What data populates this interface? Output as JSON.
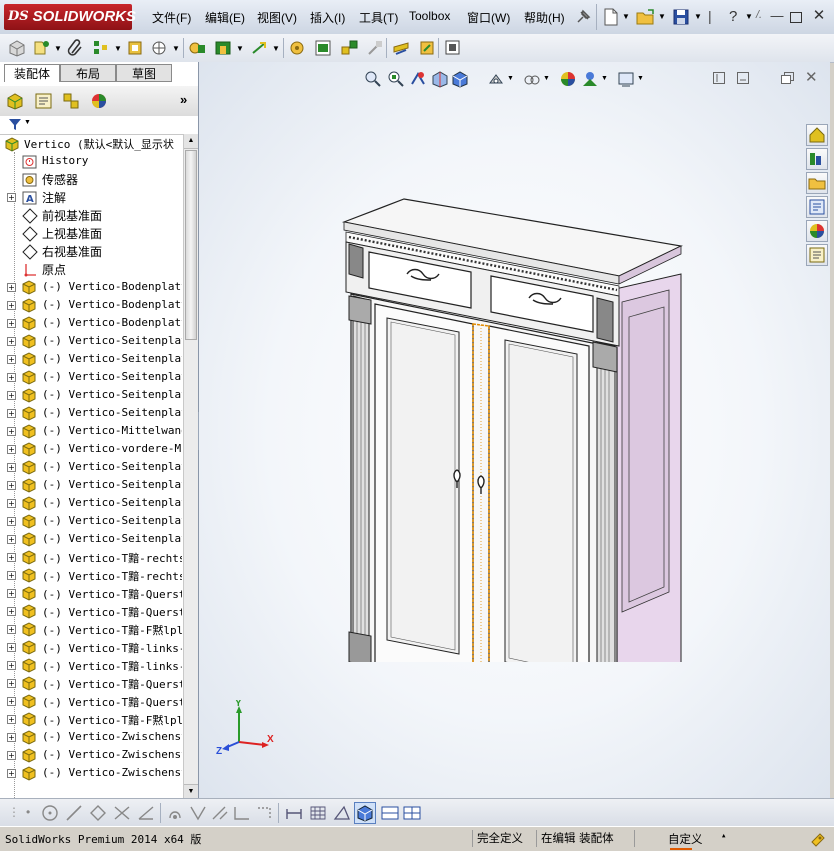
{
  "app": {
    "brand": "SOLIDWORKS",
    "brand_prefix": "DS",
    "menus": [
      {
        "label": "文件(F)"
      },
      {
        "label": "编辑(E)"
      },
      {
        "label": "视图(V)"
      },
      {
        "label": "插入(I)"
      },
      {
        "label": "工具(T)"
      },
      {
        "label": "Toolbox"
      },
      {
        "label": "窗口(W)"
      },
      {
        "label": "帮助(H)"
      }
    ]
  },
  "panel": {
    "tabs": [
      {
        "label": "装配体",
        "active": true
      },
      {
        "label": "布局",
        "active": false
      },
      {
        "label": "草图",
        "active": false
      }
    ],
    "tree": [
      {
        "label": "Vertico  (默认<默认_显示状",
        "icon": "assembly-icon",
        "expand": "",
        "cjk": false,
        "level": 0
      },
      {
        "label": "History",
        "icon": "history-icon",
        "expand": "",
        "cjk": false,
        "level": 1
      },
      {
        "label": "传感器",
        "icon": "sensor-icon",
        "expand": "",
        "cjk": true,
        "level": 1
      },
      {
        "label": "注解",
        "icon": "annotation-icon",
        "expand": "+",
        "cjk": true,
        "level": 1
      },
      {
        "label": "前视基准面",
        "icon": "plane-icon",
        "expand": "",
        "cjk": true,
        "level": 1
      },
      {
        "label": "上视基准面",
        "icon": "plane-icon",
        "expand": "",
        "cjk": true,
        "level": 1
      },
      {
        "label": "右视基准面",
        "icon": "plane-icon",
        "expand": "",
        "cjk": true,
        "level": 1
      },
      {
        "label": "原点",
        "icon": "origin-icon",
        "expand": "",
        "cjk": true,
        "level": 1
      },
      {
        "label": "(-) Vertico-Bodenplatte",
        "icon": "part-icon",
        "expand": "+",
        "cjk": false,
        "level": 1
      },
      {
        "label": "(-) Vertico-Bodenplatte",
        "icon": "part-icon",
        "expand": "+",
        "cjk": false,
        "level": 1
      },
      {
        "label": "(-) Vertico-Bodenplatte",
        "icon": "part-icon",
        "expand": "+",
        "cjk": false,
        "level": 1
      },
      {
        "label": "(-) Vertico-Seitenplatt",
        "icon": "part-icon",
        "expand": "+",
        "cjk": false,
        "level": 1
      },
      {
        "label": "(-) Vertico-Seitenplatt",
        "icon": "part-icon",
        "expand": "+",
        "cjk": false,
        "level": 1
      },
      {
        "label": "(-) Vertico-Seitenplatt",
        "icon": "part-icon",
        "expand": "+",
        "cjk": false,
        "level": 1
      },
      {
        "label": "(-) Vertico-Seitenplatt",
        "icon": "part-icon",
        "expand": "+",
        "cjk": false,
        "level": 1
      },
      {
        "label": "(-) Vertico-Seitenplatt",
        "icon": "part-icon",
        "expand": "+",
        "cjk": false,
        "level": 1
      },
      {
        "label": "(-) Vertico-Mittelwand<",
        "icon": "part-icon",
        "expand": "+",
        "cjk": false,
        "level": 1
      },
      {
        "label": "(-) Vertico-vordere-Mit",
        "icon": "part-icon",
        "expand": "+",
        "cjk": false,
        "level": 1
      },
      {
        "label": "(-) Vertico-Seitenplatt",
        "icon": "part-icon",
        "expand": "+",
        "cjk": false,
        "level": 1
      },
      {
        "label": "(-) Vertico-Seitenplatt",
        "icon": "part-icon",
        "expand": "+",
        "cjk": false,
        "level": 1
      },
      {
        "label": "(-) Vertico-Seitenplatt",
        "icon": "part-icon",
        "expand": "+",
        "cjk": false,
        "level": 1
      },
      {
        "label": "(-) Vertico-Seitenplatt",
        "icon": "part-icon",
        "expand": "+",
        "cjk": false,
        "level": 1
      },
      {
        "label": "(-) Vertico-Seitenplatt",
        "icon": "part-icon",
        "expand": "+",
        "cjk": false,
        "level": 1
      },
      {
        "label": "(-) Vertico-T黯-rechts-",
        "icon": "part-icon",
        "expand": "+",
        "cjk": false,
        "level": 1
      },
      {
        "label": "(-) Vertico-T黯-rechts-",
        "icon": "part-icon",
        "expand": "+",
        "cjk": false,
        "level": 1
      },
      {
        "label": "(-) Vertico-T黯-Querstr",
        "icon": "part-icon",
        "expand": "+",
        "cjk": false,
        "level": 1
      },
      {
        "label": "(-) Vertico-T黯-Querstr",
        "icon": "part-icon",
        "expand": "+",
        "cjk": false,
        "level": 1
      },
      {
        "label": "(-) Vertico-T黯-F黙lpla",
        "icon": "part-icon",
        "expand": "+",
        "cjk": false,
        "level": 1
      },
      {
        "label": "(-) Vertico-T黯-links-S",
        "icon": "part-icon",
        "expand": "+",
        "cjk": false,
        "level": 1
      },
      {
        "label": "(-) Vertico-T黯-links-S",
        "icon": "part-icon",
        "expand": "+",
        "cjk": false,
        "level": 1
      },
      {
        "label": "(-) Vertico-T黯-Querstr",
        "icon": "part-icon",
        "expand": "+",
        "cjk": false,
        "level": 1
      },
      {
        "label": "(-) Vertico-T黯-Querstr",
        "icon": "part-icon",
        "expand": "+",
        "cjk": false,
        "level": 1
      },
      {
        "label": "(-) Vertico-T黯-F黙lpla",
        "icon": "part-icon",
        "expand": "+",
        "cjk": false,
        "level": 1
      },
      {
        "label": "(-) Vertico-Zwischenstr",
        "icon": "part-icon",
        "expand": "+",
        "cjk": false,
        "level": 1
      },
      {
        "label": "(-) Vertico-Zwischenstr",
        "icon": "part-icon",
        "expand": "+",
        "cjk": false,
        "level": 1
      },
      {
        "label": "(-) Vertico-Zwischenstr",
        "icon": "part-icon",
        "expand": "+",
        "cjk": false,
        "level": 1
      }
    ]
  },
  "viewport": {
    "triad": {
      "x": "X",
      "y": "Y",
      "z": "Z"
    },
    "accent": "#e08a00",
    "side_color": "#e8d6ec"
  },
  "status": {
    "product": "SolidWorks Premium 2014 x64 版",
    "constraint": "完全定义",
    "mode": "在编辑 装配体",
    "units": "自定义",
    "units_caret": "▴"
  }
}
